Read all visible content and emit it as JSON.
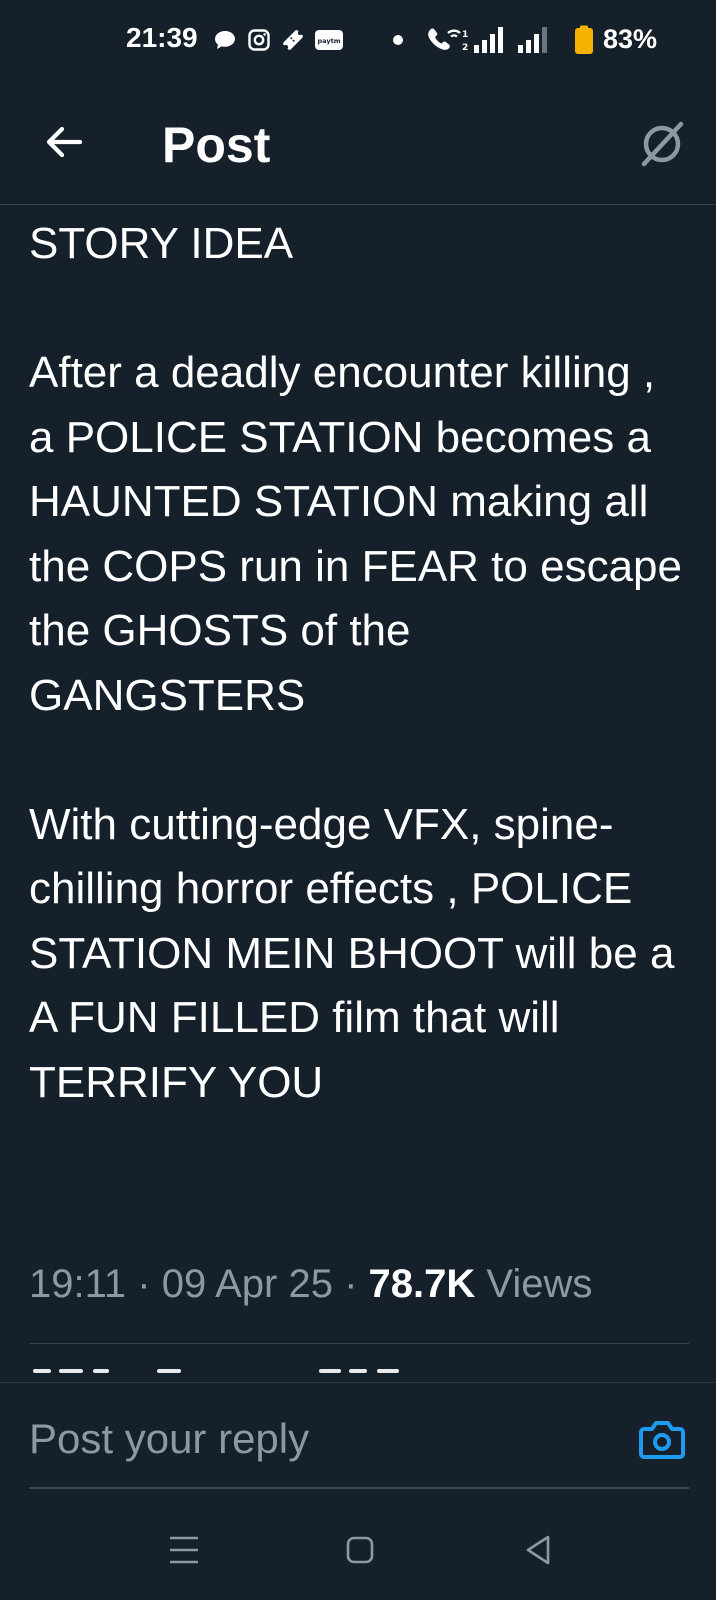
{
  "status_bar": {
    "time": "21:39",
    "battery": "83%",
    "icons": [
      "chat-bubble-icon",
      "instagram-icon",
      "ticket-icon",
      "paytm-icon",
      "dot-icon",
      "wifi-call-icon",
      "signal-icon",
      "signal-icon-2",
      "battery-icon"
    ],
    "paytm_label": "paytm"
  },
  "header": {
    "title": "Post",
    "back_icon": "arrow-left-icon",
    "right_icon": "grok-icon"
  },
  "post": {
    "heading": "STORY IDEA",
    "paragraph1": "After a deadly encounter killing , a  POLICE STATION becomes a HAUNTED STATION making all the COPS run in FEAR to escape the GHOSTS of the GANGSTERS",
    "paragraph2": "With cutting-edge VFX, spine-chilling horror effects , POLICE STATION MEIN BHOOT will be a A FUN FILLED film that will TERRIFY YOU"
  },
  "meta": {
    "time": "19:11",
    "separator": "·",
    "date": "09 Apr 25",
    "views_count": "78.7K",
    "views_label": "Views"
  },
  "reply": {
    "placeholder": "Post your reply",
    "camera_icon": "camera-icon"
  },
  "nav": {
    "recent_icon": "recent-apps-icon",
    "home_icon": "home-icon",
    "back_icon": "back-triangle-icon"
  },
  "colors": {
    "background": "#15202b",
    "text": "#ffffff",
    "muted": "#8b98a5",
    "accent": "#1d9bf0",
    "battery": "#f5b300",
    "divider": "#38444d"
  }
}
